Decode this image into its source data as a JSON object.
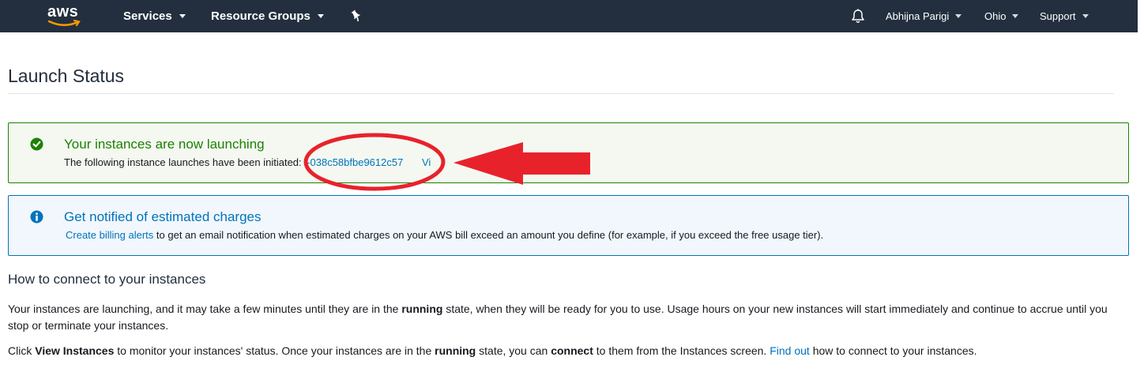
{
  "nav": {
    "logo_text": "aws",
    "services": "Services",
    "resource_groups": "Resource Groups",
    "pin_icon": "pushpin-icon",
    "bell_icon": "bell-icon",
    "user": "Abhijna Parigi",
    "region": "Ohio",
    "support": "Support"
  },
  "page": {
    "title": "Launch Status"
  },
  "success_alert": {
    "icon": "check-circle-icon",
    "title": "Your instances are now launching",
    "body_prefix": "The following instance launches have been initiated:",
    "instance_id": "i-038c58bfbe9612c57",
    "view_link": "Vi"
  },
  "info_alert": {
    "icon": "info-circle-icon",
    "title": "Get notified of estimated charges",
    "link": "Create billing alerts",
    "body": "to get an email notification when estimated charges on your AWS bill exceed an amount you define (for example, if you exceed the free usage tier)."
  },
  "connect_section": {
    "heading": "How to connect to your instances",
    "para1_a": "Your instances are launching, and it may take a few minutes until they are in the",
    "para1_bold": "running",
    "para1_b": "state, when they will be ready for you to use. Usage hours on your new instances will start immediately and continue to accrue until you stop or terminate your instances.",
    "para2_a": "Click",
    "para2_bold1": "View Instances",
    "para2_b": "to monitor your instances' status. Once your instances are in the",
    "para2_bold2": "running",
    "para2_c": "state, you can",
    "para2_bold3": "connect",
    "para2_d": "to them from the Instances screen.",
    "para2_link": "Find out",
    "para2_e": "how to connect to your instances."
  },
  "colors": {
    "nav_bg": "#232f3e",
    "success": "#1d8102",
    "info": "#0073bb",
    "annotation_red": "#e8222b"
  }
}
